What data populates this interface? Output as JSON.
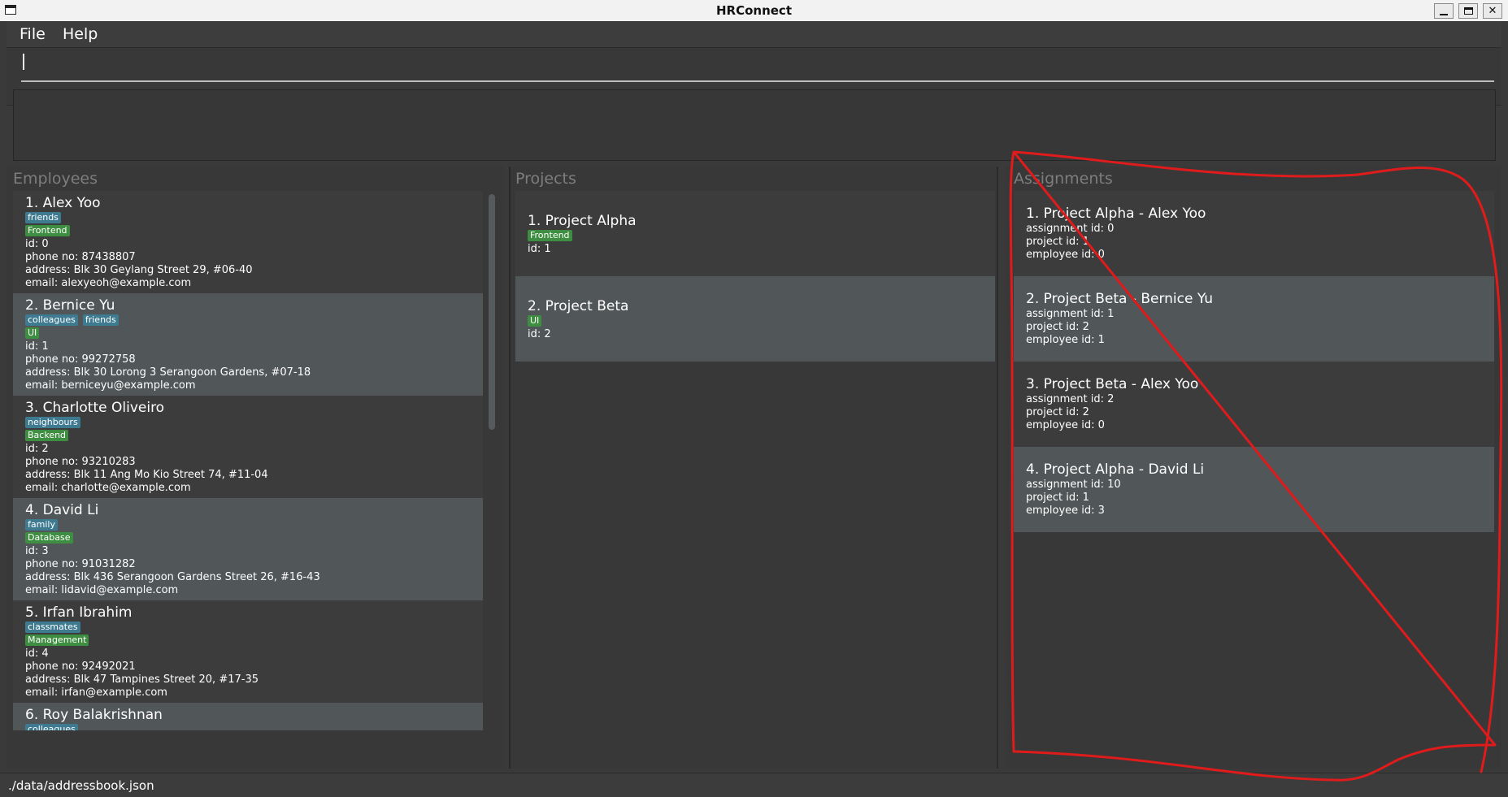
{
  "window": {
    "title": "HRConnect"
  },
  "menu": {
    "file": "File",
    "help": "Help"
  },
  "command": {
    "value": "",
    "placeholder": ""
  },
  "result": {
    "text": ""
  },
  "employees": {
    "title": "Employees",
    "items": [
      {
        "name": "1. Alex Yoo",
        "tags": [
          "friends"
        ],
        "roles": [
          "Frontend"
        ],
        "id": "id: 0",
        "phone": "phone no: 87438807",
        "address": "address: Blk 30 Geylang Street 29, #06-40",
        "email": "email: alexyeoh@example.com"
      },
      {
        "name": "2. Bernice Yu",
        "tags": [
          "colleagues",
          "friends"
        ],
        "roles": [
          "UI"
        ],
        "id": "id: 1",
        "phone": "phone no: 99272758",
        "address": "address: Blk 30 Lorong 3 Serangoon Gardens, #07-18",
        "email": "email: berniceyu@example.com"
      },
      {
        "name": "3. Charlotte Oliveiro",
        "tags": [
          "neighbours"
        ],
        "roles": [
          "Backend"
        ],
        "id": "id: 2",
        "phone": "phone no: 93210283",
        "address": "address: Blk 11 Ang Mo Kio Street 74, #11-04",
        "email": "email: charlotte@example.com"
      },
      {
        "name": "4. David Li",
        "tags": [
          "family"
        ],
        "roles": [
          "Database"
        ],
        "id": "id: 3",
        "phone": "phone no: 91031282",
        "address": "address: Blk 436 Serangoon Gardens Street 26, #16-43",
        "email": "email: lidavid@example.com"
      },
      {
        "name": "5. Irfan Ibrahim",
        "tags": [
          "classmates"
        ],
        "roles": [
          "Management"
        ],
        "id": "id: 4",
        "phone": "phone no: 92492021",
        "address": "address: Blk 47 Tampines Street 20, #17-35",
        "email": "email: irfan@example.com"
      },
      {
        "name": "6. Roy Balakrishnan",
        "tags": [
          "colleagues"
        ],
        "roles": [],
        "id": "",
        "phone": "",
        "address": "",
        "email": ""
      }
    ]
  },
  "projects": {
    "title": "Projects",
    "items": [
      {
        "name": "1. Project Alpha",
        "roles": [
          "Frontend"
        ],
        "id": "id: 1"
      },
      {
        "name": "2. Project Beta",
        "roles": [
          "UI"
        ],
        "id": "id: 2"
      }
    ]
  },
  "assignments": {
    "title": "Assignments",
    "items": [
      {
        "name": "1. Project Alpha - Alex Yoo",
        "assignment_id": "assignment id: 0",
        "project_id": "project id: 1",
        "employee_id": "employee id: 0"
      },
      {
        "name": "2. Project Beta - Bernice Yu",
        "assignment_id": "assignment id: 1",
        "project_id": "project id: 2",
        "employee_id": "employee id: 1"
      },
      {
        "name": "3. Project Beta - Alex Yoo",
        "assignment_id": "assignment id: 2",
        "project_id": "project id: 2",
        "employee_id": "employee id: 0"
      },
      {
        "name": "4. Project Alpha - David Li",
        "assignment_id": "assignment id: 10",
        "project_id": "project id: 1",
        "employee_id": "employee id: 3"
      }
    ]
  },
  "status": {
    "path": "./data/addressbook.json"
  },
  "colors": {
    "background": "#3a3a3a",
    "card_alt": "#515658",
    "tag_blue": "#3e7b91",
    "tag_green": "#3e8e41",
    "annotation_red": "#e01b1b"
  },
  "icons": {
    "app": "window-icon",
    "minimize": "minimize-icon",
    "maximize": "maximize-icon",
    "close": "close-icon"
  }
}
